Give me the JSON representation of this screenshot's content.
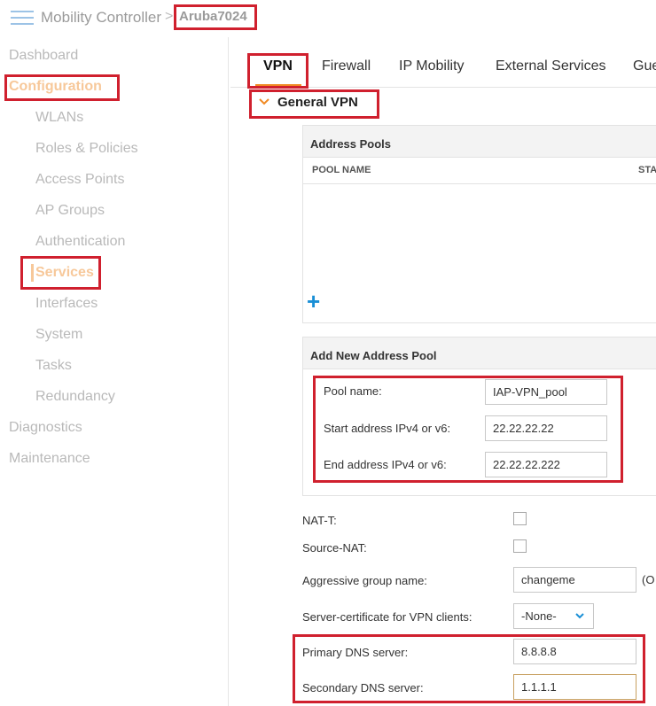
{
  "header": {
    "brand": "Mobility Controller",
    "separator": ">",
    "device": "Aruba7024"
  },
  "sidebar": {
    "items": [
      {
        "label": "Dashboard",
        "level": "top"
      },
      {
        "label": "Configuration",
        "level": "top",
        "active": true
      },
      {
        "label": "WLANs",
        "level": "sub"
      },
      {
        "label": "Roles & Policies",
        "level": "sub"
      },
      {
        "label": "Access Points",
        "level": "sub"
      },
      {
        "label": "AP Groups",
        "level": "sub"
      },
      {
        "label": "Authentication",
        "level": "sub"
      },
      {
        "label": "Services",
        "level": "sub",
        "active": true
      },
      {
        "label": "Interfaces",
        "level": "sub"
      },
      {
        "label": "System",
        "level": "sub"
      },
      {
        "label": "Tasks",
        "level": "sub"
      },
      {
        "label": "Redundancy",
        "level": "sub"
      },
      {
        "label": "Diagnostics",
        "level": "top"
      },
      {
        "label": "Maintenance",
        "level": "top"
      }
    ]
  },
  "tabs": [
    "VPN",
    "Firewall",
    "IP Mobility",
    "External Services",
    "Gue"
  ],
  "section": {
    "title": "General VPN"
  },
  "address_pools": {
    "title": "Address Pools",
    "columns": [
      "POOL NAME",
      "STA"
    ]
  },
  "add_pool": {
    "title": "Add New Address Pool",
    "pool_name_label": "Pool name:",
    "pool_name_value": "IAP-VPN_pool",
    "start_label": "Start address IPv4 or v6:",
    "start_value": "22.22.22.22",
    "end_label": "End address IPv4 or v6:",
    "end_value": "22.22.22.222"
  },
  "settings": {
    "nat_t_label": "NAT-T:",
    "source_nat_label": "Source-NAT:",
    "aggressive_label": "Aggressive group name:",
    "aggressive_value": "changeme",
    "aggressive_note": "(O",
    "server_cert_label": "Server-certificate for VPN clients:",
    "server_cert_value": "-None-",
    "primary_dns_label": "Primary DNS server:",
    "primary_dns_value": "8.8.8.8",
    "secondary_dns_label": "Secondary DNS server:",
    "secondary_dns_value": "1.1.1.1"
  },
  "colors": {
    "accent": "#f08a24",
    "active_nav": "#f7c89a",
    "highlight": "#d0202e",
    "add_icon": "#1a8fd6"
  }
}
